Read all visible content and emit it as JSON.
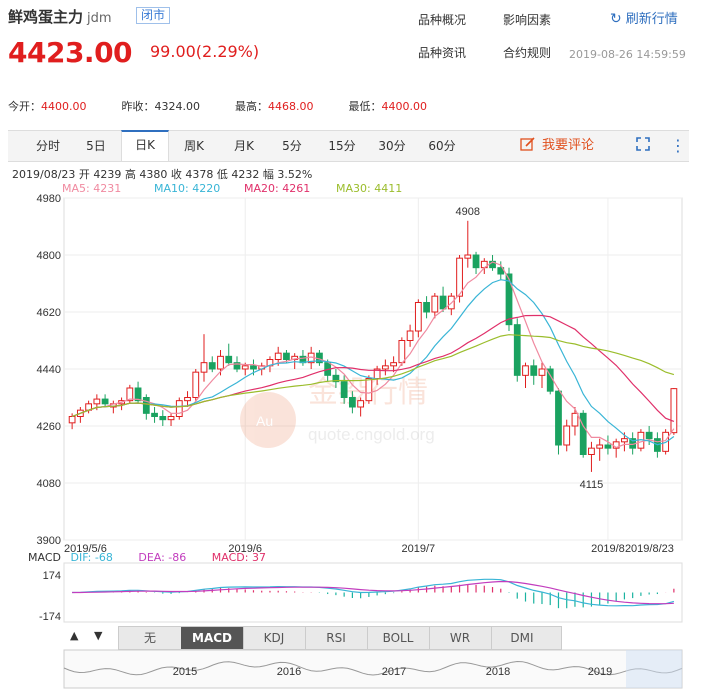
{
  "header": {
    "name": "鲜鸡蛋主力",
    "code": "jdm",
    "status_badge": "闭市",
    "price": "4423.00",
    "change": "99.00(2.29%)",
    "links": [
      "品种概况",
      "影响因素",
      "品种资讯",
      "合约规则"
    ],
    "refresh_label": "刷新行情",
    "datetime": "2019-08-26 14:59:59"
  },
  "stats": {
    "open_label": "今开：",
    "open": "4400.00",
    "prev_close_label": "昨收：",
    "prev_close": "4324.00",
    "high_label": "最高：",
    "high": "4468.00",
    "low_label": "最低：",
    "low": "4400.00"
  },
  "tabs": [
    "分时",
    "5日",
    "日K",
    "周K",
    "月K",
    "5分",
    "15分",
    "30分",
    "60分"
  ],
  "active_tab": "日K",
  "comment_label": "我要评论",
  "ohlc_line": "2019/08/23  开 4239  高 4380  收 4378  低 4232  幅 3.52%",
  "ma": [
    {
      "label": "MA5: 4231",
      "color": "#f08aa0"
    },
    {
      "label": "MA10: 4220",
      "color": "#39b5d6"
    },
    {
      "label": "MA20: 4261",
      "color": "#e0306a"
    },
    {
      "label": "MA30: 4411",
      "color": "#9bbd2c"
    }
  ],
  "watermark": {
    "text": "金投行情",
    "url": "quote.cngold.org",
    "logo": "Au"
  },
  "macd_header": {
    "macd_label": "MACD",
    "dif": "DIF: -68",
    "dea": "DEA: -86",
    "macd": "MACD: 37"
  },
  "bottom_tabs": [
    "无",
    "MACD",
    "KDJ",
    "RSI",
    "BOLL",
    "WR",
    "DMI"
  ],
  "bottom_active": "MACD",
  "navigator_years": [
    "2015",
    "2016",
    "2017",
    "2018",
    "2019"
  ],
  "colors": {
    "up": "#e01e1e",
    "down": "#1aa260",
    "accent": "#2f6fbf"
  },
  "chart_data": {
    "type": "candlestick",
    "y_ticks": [
      "4980",
      "4800",
      "4620",
      "4440",
      "4260",
      "4080",
      "3900"
    ],
    "ylim": [
      3900,
      4980
    ],
    "x_labels": [
      "2019/5/6",
      "2019/6",
      "2019/7",
      "2019/8",
      "2019/8/23"
    ],
    "annotations": {
      "max": "4908",
      "min": "4115"
    },
    "macd_ticks": [
      "174",
      "-174"
    ],
    "candles": [
      [
        4270,
        4300,
        4250,
        4290
      ],
      [
        4290,
        4320,
        4270,
        4310
      ],
      [
        4310,
        4340,
        4300,
        4330
      ],
      [
        4330,
        4360,
        4310,
        4345
      ],
      [
        4345,
        4360,
        4320,
        4330
      ],
      [
        4320,
        4340,
        4300,
        4330
      ],
      [
        4330,
        4350,
        4310,
        4340
      ],
      [
        4340,
        4390,
        4330,
        4380
      ],
      [
        4380,
        4400,
        4330,
        4340
      ],
      [
        4350,
        4360,
        4280,
        4300
      ],
      [
        4300,
        4320,
        4270,
        4290
      ],
      [
        4290,
        4310,
        4260,
        4280
      ],
      [
        4280,
        4300,
        4260,
        4290
      ],
      [
        4290,
        4350,
        4280,
        4340
      ],
      [
        4340,
        4370,
        4320,
        4350
      ],
      [
        4350,
        4440,
        4340,
        4430
      ],
      [
        4430,
        4550,
        4400,
        4460
      ],
      [
        4460,
        4480,
        4430,
        4440
      ],
      [
        4440,
        4500,
        4420,
        4480
      ],
      [
        4480,
        4520,
        4450,
        4460
      ],
      [
        4460,
        4480,
        4430,
        4440
      ],
      [
        4440,
        4460,
        4420,
        4450
      ],
      [
        4450,
        4470,
        4420,
        4440
      ],
      [
        4440,
        4460,
        4420,
        4450
      ],
      [
        4450,
        4480,
        4430,
        4470
      ],
      [
        4470,
        4510,
        4450,
        4490
      ],
      [
        4490,
        4500,
        4460,
        4470
      ],
      [
        4470,
        4490,
        4440,
        4480
      ],
      [
        4480,
        4500,
        4450,
        4460
      ],
      [
        4460,
        4510,
        4440,
        4490
      ],
      [
        4490,
        4500,
        4450,
        4460
      ],
      [
        4460,
        4470,
        4400,
        4420
      ],
      [
        4420,
        4440,
        4380,
        4400
      ],
      [
        4400,
        4420,
        4330,
        4350
      ],
      [
        4350,
        4370,
        4300,
        4320
      ],
      [
        4320,
        4350,
        4290,
        4340
      ],
      [
        4340,
        4420,
        4330,
        4410
      ],
      [
        4410,
        4450,
        4390,
        4440
      ],
      [
        4440,
        4470,
        4420,
        4450
      ],
      [
        4450,
        4480,
        4430,
        4460
      ],
      [
        4460,
        4540,
        4450,
        4530
      ],
      [
        4530,
        4580,
        4510,
        4560
      ],
      [
        4560,
        4660,
        4540,
        4650
      ],
      [
        4650,
        4670,
        4600,
        4620
      ],
      [
        4620,
        4680,
        4600,
        4670
      ],
      [
        4670,
        4700,
        4620,
        4630
      ],
      [
        4630,
        4680,
        4610,
        4670
      ],
      [
        4670,
        4800,
        4650,
        4790
      ],
      [
        4790,
        4908,
        4760,
        4800
      ],
      [
        4800,
        4810,
        4740,
        4760
      ],
      [
        4760,
        4790,
        4740,
        4780
      ],
      [
        4780,
        4800,
        4750,
        4760
      ],
      [
        4760,
        4780,
        4720,
        4740
      ],
      [
        4740,
        4760,
        4560,
        4580
      ],
      [
        4580,
        4600,
        4400,
        4420
      ],
      [
        4420,
        4460,
        4380,
        4450
      ],
      [
        4450,
        4470,
        4390,
        4420
      ],
      [
        4420,
        4460,
        4380,
        4440
      ],
      [
        4440,
        4450,
        4360,
        4370
      ],
      [
        4370,
        4380,
        4170,
        4200
      ],
      [
        4200,
        4280,
        4180,
        4260
      ],
      [
        4260,
        4320,
        4230,
        4300
      ],
      [
        4300,
        4310,
        4160,
        4170
      ],
      [
        4170,
        4210,
        4115,
        4190
      ],
      [
        4190,
        4220,
        4150,
        4200
      ],
      [
        4200,
        4230,
        4170,
        4190
      ],
      [
        4190,
        4220,
        4160,
        4210
      ],
      [
        4210,
        4240,
        4180,
        4220
      ],
      [
        4220,
        4240,
        4170,
        4190
      ],
      [
        4190,
        4250,
        4180,
        4240
      ],
      [
        4240,
        4260,
        4200,
        4220
      ],
      [
        4220,
        4240,
        4160,
        4180
      ],
      [
        4180,
        4250,
        4170,
        4240
      ],
      [
        4239,
        4380,
        4232,
        4378
      ]
    ]
  }
}
